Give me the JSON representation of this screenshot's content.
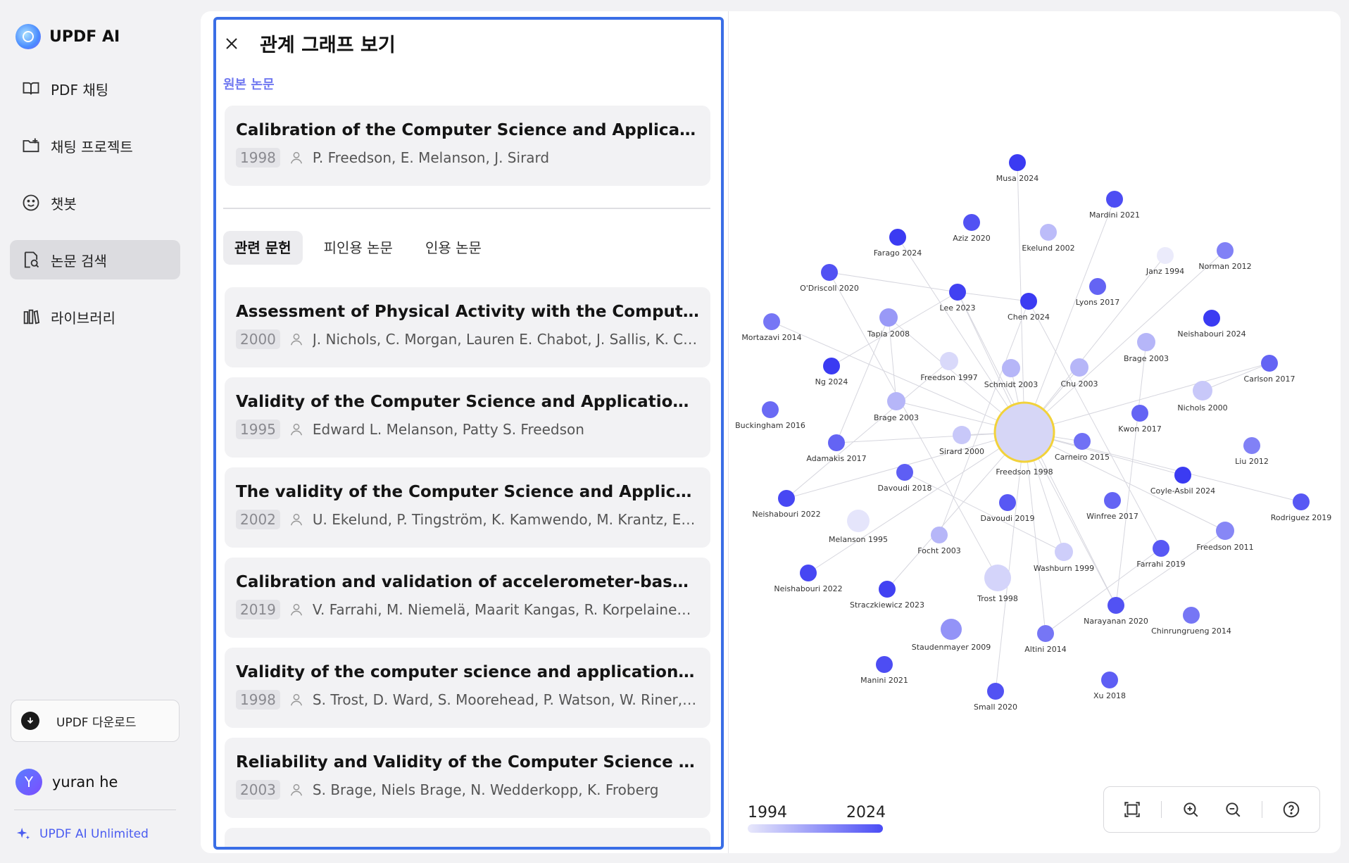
{
  "brand": {
    "name": "UPDF AI"
  },
  "sidebar": {
    "items": [
      {
        "label": "PDF 채팅",
        "icon": "book-open-icon"
      },
      {
        "label": "채팅 프로젝트",
        "icon": "folder-plus-icon"
      },
      {
        "label": "챗봇",
        "icon": "smile-bot-icon"
      },
      {
        "label": "논문 검색",
        "icon": "paper-search-icon",
        "active": true
      },
      {
        "label": "라이브러리",
        "icon": "library-icon"
      }
    ],
    "download_label": "UPDF 다운로드",
    "user": {
      "initial": "Y",
      "name": "yuran he"
    },
    "unlimited_label": "UPDF AI Unlimited"
  },
  "panel": {
    "title": "관계 그래프 보기",
    "section_label": "원본 논문",
    "original": {
      "title": "Calibration of the Computer Science and Applications, I...",
      "year": "1998",
      "authors": "P. Freedson, E. Melanson, J. Sirard"
    },
    "tabs": [
      {
        "label": "관련 문헌",
        "active": true
      },
      {
        "label": "피인용 논문"
      },
      {
        "label": "인용 논문"
      }
    ],
    "papers": [
      {
        "title": "Assessment of Physical Activity with the Computer Scie...",
        "year": "2000",
        "authors": "J. Nichols, C. Morgan, Lauren E. Chabot, J. Sallis, K. Cal..."
      },
      {
        "title": "Validity of the Computer Science and Applications, Inc. ...",
        "year": "1995",
        "authors": "Edward L. Melanson, Patty S. Freedson"
      },
      {
        "title": "The validity of the Computer Science and Applications ...",
        "year": "2002",
        "authors": "U. Ekelund, P. Tingström, K. Kamwendo, M. Krantz, E. Ny..."
      },
      {
        "title": "Calibration and validation of accelerometer-based acti...",
        "year": "2019",
        "authors": "V. Farrahi, M. Niemelä, Maarit Kangas, R. Korpelainen, T. ..."
      },
      {
        "title": "Validity of the computer science and applications (CSA...",
        "year": "1998",
        "authors": "S. Trost, D. Ward, S. Moorehead, P. Watson, W. Riner, J. B..."
      },
      {
        "title": "Reliability and Validity of the Computer Science and Ap...",
        "year": "2003",
        "authors": "S. Brage, Niels Brage, N. Wedderkopp, K. Froberg"
      }
    ]
  },
  "graph": {
    "center": "Freedson 1998",
    "colors": {
      "old": "#ebebfb",
      "new": "#3b3bf2",
      "center_ring": "#f2d23a"
    },
    "nodes": [
      {
        "label": "Musa 2024",
        "year": 2024
      },
      {
        "label": "Mardini 2021",
        "year": 2021
      },
      {
        "label": "Aziz 2020",
        "year": 2020
      },
      {
        "label": "Farago 2024",
        "year": 2024
      },
      {
        "label": "Ekelund 2002",
        "year": 2002
      },
      {
        "label": "Janz 1994",
        "year": 1994
      },
      {
        "label": "Norman 2012",
        "year": 2012
      },
      {
        "label": "O'Driscoll 2020",
        "year": 2020
      },
      {
        "label": "Lyons 2017",
        "year": 2017
      },
      {
        "label": "Lee 2023",
        "year": 2023
      },
      {
        "label": "Chen 2024",
        "year": 2024
      },
      {
        "label": "Neishabouri 2024",
        "year": 2024
      },
      {
        "label": "Mortazavi 2014",
        "year": 2014
      },
      {
        "label": "Tapia 2008",
        "year": 2008
      },
      {
        "label": "Brage 2003",
        "year": 2003
      },
      {
        "label": "Carlson 2017",
        "year": 2017
      },
      {
        "label": "Freedson 1997",
        "year": 1997
      },
      {
        "label": "Schmidt 2003",
        "year": 2003
      },
      {
        "label": "Chu 2003",
        "year": 2003
      },
      {
        "label": "Ng 2024",
        "year": 2024
      },
      {
        "label": "Nichols 2000",
        "year": 2000
      },
      {
        "label": "Brage 2003",
        "year": 2003
      },
      {
        "label": "Kwon 2017",
        "year": 2017
      },
      {
        "label": "Buckingham 2016",
        "year": 2016
      },
      {
        "label": "Sirard 2000",
        "year": 2000
      },
      {
        "label": "Carneiro 2015",
        "year": 2015
      },
      {
        "label": "Liu 2012",
        "year": 2012
      },
      {
        "label": "Adamakis 2017",
        "year": 2017
      },
      {
        "label": "Davoudi 2018",
        "year": 2018
      },
      {
        "label": "Coyle-Asbil 2024",
        "year": 2024
      },
      {
        "label": "Neishabouri 2022",
        "year": 2022
      },
      {
        "label": "Davoudi 2019",
        "year": 2019
      },
      {
        "label": "Winfree 2017",
        "year": 2017
      },
      {
        "label": "Rodriguez 2019",
        "year": 2019
      },
      {
        "label": "Melanson 1995",
        "year": 1995
      },
      {
        "label": "Focht 2003",
        "year": 2003
      },
      {
        "label": "Freedson 2011",
        "year": 2011
      },
      {
        "label": "Washburn 1999",
        "year": 1999
      },
      {
        "label": "Farrahi 2019",
        "year": 2019
      },
      {
        "label": "Neishabouri 2022",
        "year": 2022
      },
      {
        "label": "Trost 1998",
        "year": 1998
      },
      {
        "label": "Straczkiewicz 2023",
        "year": 2023
      },
      {
        "label": "Narayanan 2020",
        "year": 2020
      },
      {
        "label": "Chinrungrueng 2014",
        "year": 2014
      },
      {
        "label": "Staudenmayer 2009",
        "year": 2009
      },
      {
        "label": "Altini 2014",
        "year": 2014
      },
      {
        "label": "Manini 2021",
        "year": 2021
      },
      {
        "label": "Xu 2018",
        "year": 2018
      },
      {
        "label": "Small 2020",
        "year": 2020
      }
    ],
    "legend": {
      "min_year": "1994",
      "max_year": "2024"
    }
  },
  "toolbar": {
    "buttons": [
      {
        "name": "fit-view-button",
        "icon": "fit-screen-icon"
      },
      {
        "name": "zoom-in-button",
        "icon": "zoom-in-icon"
      },
      {
        "name": "zoom-out-button",
        "icon": "zoom-out-icon"
      },
      {
        "name": "help-button",
        "icon": "help-icon"
      }
    ]
  }
}
